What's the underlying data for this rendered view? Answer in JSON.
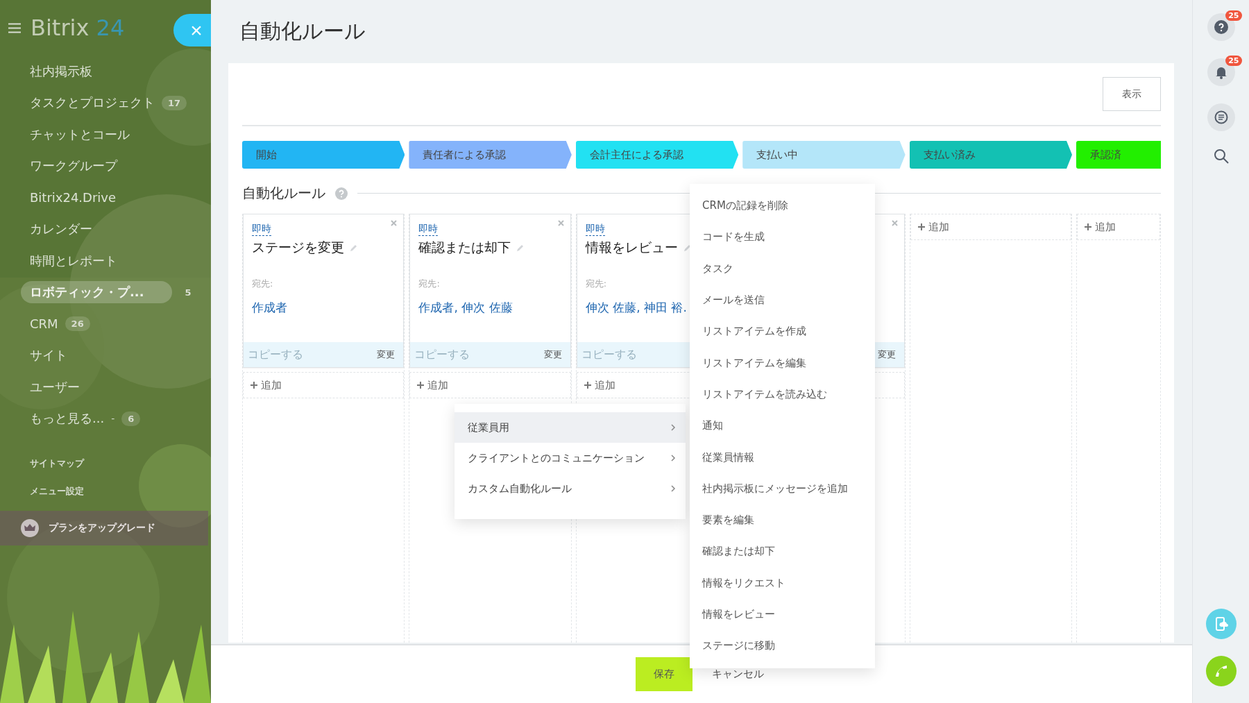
{
  "sidebar": {
    "logo": {
      "name": "Bitrix",
      "number": "24"
    },
    "close_button": "×",
    "items": [
      {
        "label": "社内掲示板",
        "selected": false
      },
      {
        "label": "タスクとプロジェクト",
        "count": "17",
        "selected": false
      },
      {
        "label": "チャットとコール",
        "selected": false
      },
      {
        "label": "ワークグループ",
        "selected": false
      },
      {
        "label": "Bitrix24.Drive",
        "selected": false
      },
      {
        "label": "カレンダー",
        "selected": false
      },
      {
        "label": "時間とレポート",
        "selected": false
      },
      {
        "label": "ロボティック・プ...",
        "count": "5",
        "selected": true
      },
      {
        "label": "CRM",
        "count": "26",
        "selected": false
      },
      {
        "label": "サイト",
        "selected": false
      },
      {
        "label": "ユーザー",
        "selected": false
      },
      {
        "label": "もっと見る...",
        "count": "6",
        "selected": false
      }
    ],
    "more_caret": "-",
    "links": [
      "サイトマップ",
      "メニュー設定"
    ],
    "upgrade": "プランをアップグレード"
  },
  "page": {
    "title": "自動化ルール",
    "view_button": "表示",
    "stages": [
      {
        "label": "開始",
        "color": "#22b5f3"
      },
      {
        "label": "責任者による承認",
        "color": "#84b3fb"
      },
      {
        "label": "会計主任による承認",
        "color": "#22e1f2"
      },
      {
        "label": "支払い中",
        "color": "#b4e6f9"
      },
      {
        "label": "支払い済み",
        "color": "#13c1b3"
      },
      {
        "label": "承認済",
        "color": "#22ef00"
      }
    ],
    "section_title": "自動化ルール",
    "columns": [
      {
        "cards": [
          {
            "timing": "即時",
            "title": "ステージを変更",
            "recipient_label": "宛先:",
            "recipients": "作成者",
            "closable": true,
            "copy": "コピーする",
            "change": "変更"
          }
        ],
        "add": "追加"
      },
      {
        "cards": [
          {
            "timing": "即時",
            "title": "確認または却下",
            "recipient_label": "宛先:",
            "recipients": "作成者, 伸次 佐藤",
            "closable": true,
            "copy": "コピーする",
            "change": "変更"
          }
        ],
        "add": "追加"
      },
      {
        "cards": [
          {
            "timing": "即時",
            "title": "情報をレビュー",
            "recipient_label": "宛先:",
            "recipients": "伸次 佐藤, 神田 裕.",
            "copy": "コピーする"
          }
        ],
        "add": "追加"
      },
      {
        "cards": [
          {
            "closable": true,
            "change": "変更"
          }
        ]
      },
      {
        "add": "追加"
      },
      {
        "add": "追加"
      }
    ],
    "footer": {
      "save": "保存",
      "cancel": "キャンセル"
    }
  },
  "category_menu": [
    {
      "label": "従業員用",
      "selected": true
    },
    {
      "label": "クライアントとのコミュニケーション",
      "selected": false
    },
    {
      "label": "カスタム自動化ルール",
      "selected": false
    }
  ],
  "action_menu": [
    "CRMの記録を削除",
    "コードを生成",
    "タスク",
    "メールを送信",
    "リストアイテムを作成",
    "リストアイテムを編集",
    "リストアイテムを読み込む",
    "通知",
    "従業員情報",
    "社内掲示板にメッセージを追加",
    "要素を編集",
    "確認または却下",
    "情報をリクエスト",
    "情報をレビュー",
    "ステージに移動"
  ],
  "right_bar": {
    "help_badge": "25",
    "bell_badge": "25"
  }
}
